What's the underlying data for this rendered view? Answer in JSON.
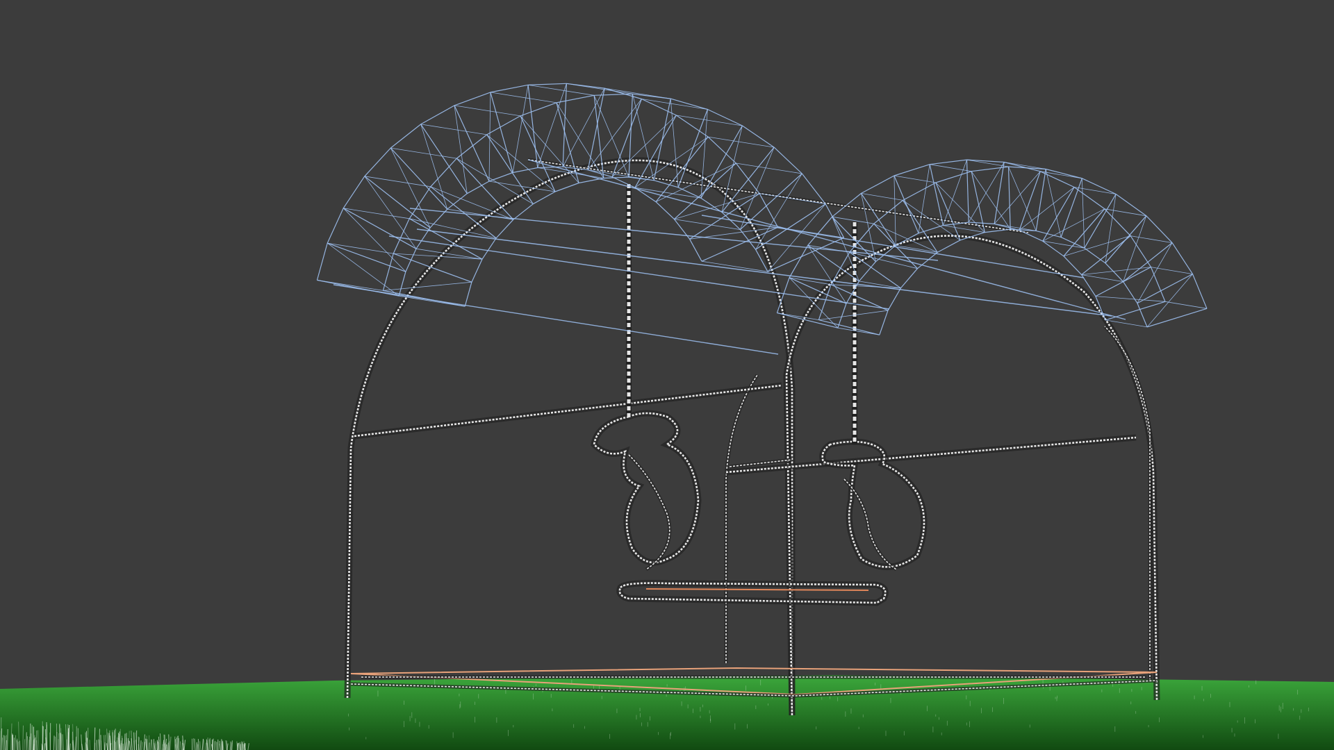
{
  "viewport": {
    "background_color": "#3c3c3c",
    "render_mode": "wireframe"
  },
  "scene": {
    "object": "swing-set",
    "colors": {
      "selected_wireframe": "#9ec1f2",
      "frame_wireframe": "#e6e6e6",
      "frame_shadow": "#222222",
      "seat_highlight": "#e0865a",
      "base_outline": "#e8a27a",
      "ground_light": "#3ca83c",
      "ground_dark": "#114a11",
      "grass_blades": "#d8ead8"
    },
    "icons": {
      "canopy": "canopy-wireframe-icon",
      "frame": "frame-wireframe-icon",
      "chains": "chain-icon",
      "seat": "swing-seat-icon",
      "ground": "ground-plane-icon"
    }
  }
}
